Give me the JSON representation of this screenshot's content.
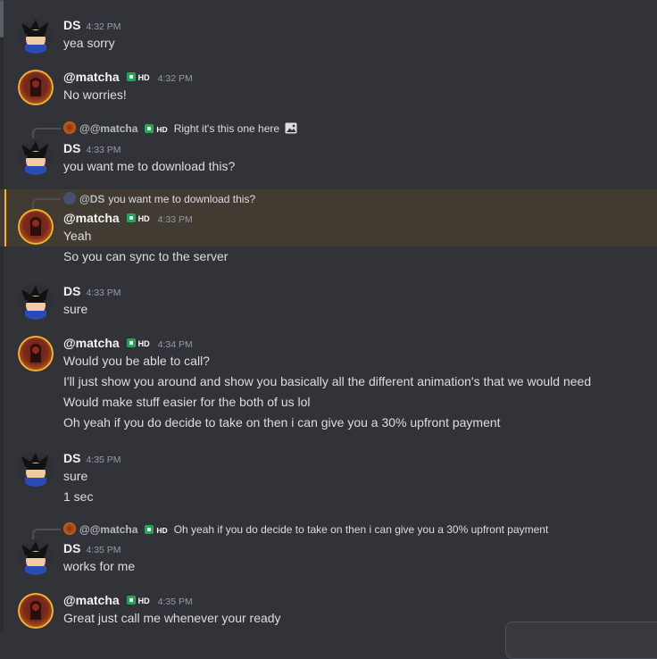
{
  "users": {
    "ds": {
      "name": "DS"
    },
    "matcha": {
      "name": "@matcha",
      "badge": "HD"
    }
  },
  "messages": [
    {
      "author": "DS",
      "time": "4:32 PM",
      "lines": [
        "yea sorry"
      ]
    },
    {
      "author": "@matcha",
      "time": "4:32 PM",
      "lines": [
        "No worries!"
      ]
    },
    {
      "author": "DS",
      "time": "4:33 PM",
      "lines": [
        "you want me to download this?"
      ],
      "reply": {
        "name": "@@matcha",
        "badge": "HD",
        "text": "Right it's this one here"
      }
    },
    {
      "author": "@matcha",
      "time": "4:33 PM",
      "lines": [
        "Yeah",
        "So you can sync to the server"
      ],
      "reply": {
        "name": "@DS",
        "text": "you want me to download this?"
      }
    },
    {
      "author": "DS",
      "time": "4:33 PM",
      "lines": [
        "sure"
      ]
    },
    {
      "author": "@matcha",
      "time": "4:34 PM",
      "lines": [
        "Would you be able to call?",
        "I'll just show you around and show you basically all the different animation's that we would need",
        "Would make stuff easier for the both of us lol",
        "Oh yeah if you do decide to take on then i can give you a 30% upfront payment"
      ]
    },
    {
      "author": "DS",
      "time": "4:35 PM",
      "lines": [
        "sure",
        "1 sec"
      ]
    },
    {
      "author": "DS",
      "time": "4:35 PM",
      "lines": [
        "works for me"
      ],
      "reply": {
        "name": "@@matcha",
        "badge": "HD",
        "text": "Oh yeah if you do decide to take on then i can give you a 30% upfront payment"
      }
    },
    {
      "author": "@matcha",
      "time": "4:35 PM",
      "lines": [
        "Great just call me whenever your ready"
      ]
    }
  ]
}
